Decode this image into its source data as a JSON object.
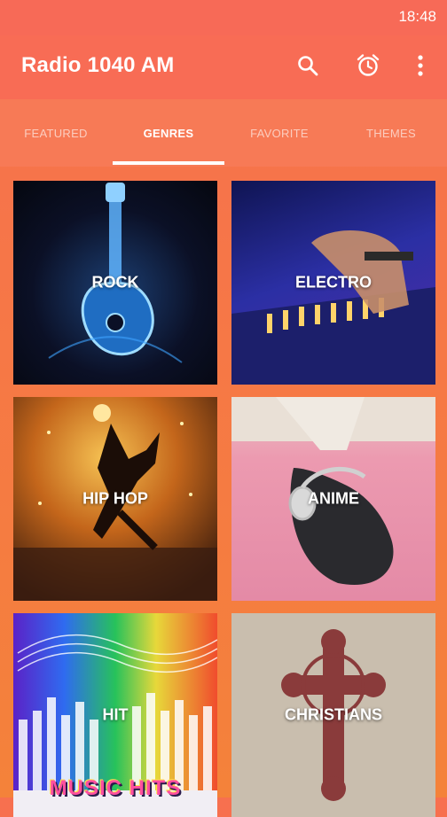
{
  "status_bar": {
    "time": "18:48"
  },
  "app_bar": {
    "title": "Radio 1040 AM",
    "icons": [
      "search-icon",
      "alarm-clock-icon",
      "more-vert-icon"
    ]
  },
  "tabs": [
    {
      "label": "FEATURED",
      "active": false
    },
    {
      "label": "GENRES",
      "active": true
    },
    {
      "label": "FAVORITE",
      "active": false
    },
    {
      "label": "THEMES",
      "active": false
    }
  ],
  "genres": [
    {
      "label": "ROCK"
    },
    {
      "label": "ELECTRO"
    },
    {
      "label": "HIP HOP"
    },
    {
      "label": "ANIME"
    },
    {
      "label": "HIT",
      "banner": "MUSIC HITS"
    },
    {
      "label": "CHRISTIANS"
    }
  ],
  "colors": {
    "app_bar": "#f86c55",
    "tabs_bg": "#f77a56",
    "background": "#f4823a",
    "active_tab": "#ffffff"
  }
}
